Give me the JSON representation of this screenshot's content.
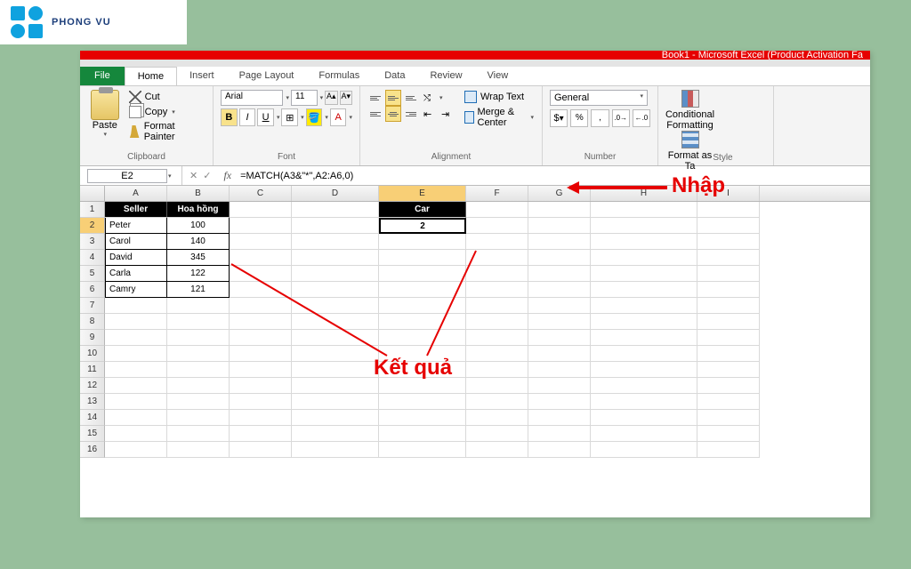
{
  "logo": {
    "text": "PHONG VU"
  },
  "window": {
    "title": "Book1 - Microsoft Excel (Product Activation Fa"
  },
  "tabs": {
    "file": "File",
    "home": "Home",
    "insert": "Insert",
    "page_layout": "Page Layout",
    "formulas": "Formulas",
    "data": "Data",
    "review": "Review",
    "view": "View"
  },
  "ribbon": {
    "clipboard": {
      "label": "Clipboard",
      "paste": "Paste",
      "cut": "Cut",
      "copy": "Copy",
      "fmt": "Format Painter"
    },
    "font": {
      "label": "Font",
      "name": "Arial",
      "size": "11",
      "bold": "B",
      "italic": "I",
      "underline": "U"
    },
    "alignment": {
      "label": "Alignment",
      "wrap": "Wrap Text",
      "merge": "Merge & Center"
    },
    "number": {
      "label": "Number",
      "format": "General",
      "currency": "$",
      "percent": "%",
      "comma": ",",
      "inc": ".0←",
      "dec": "→.0"
    },
    "styles": {
      "label": "Style",
      "conditional": "Conditional Formatting",
      "table": "Format as Ta"
    }
  },
  "formula_bar": {
    "name_box": "E2",
    "formula": "=MATCH(A3&\"*\",A2:A6,0)"
  },
  "columns": [
    "A",
    "B",
    "C",
    "D",
    "E",
    "F",
    "G",
    "H",
    "I"
  ],
  "rows_count": 16,
  "table": {
    "headers": {
      "seller": "Seller",
      "commission": "Hoa hồng"
    },
    "rows": [
      {
        "seller": "Peter",
        "value": "100"
      },
      {
        "seller": "Carol",
        "value": "140"
      },
      {
        "seller": "David",
        "value": "345"
      },
      {
        "seller": "Carla",
        "value": "122"
      },
      {
        "seller": "Camry",
        "value": "121"
      }
    ]
  },
  "result": {
    "header": "Car",
    "value": "2"
  },
  "annotations": {
    "input": "Nhập",
    "result": "Kết quả"
  }
}
